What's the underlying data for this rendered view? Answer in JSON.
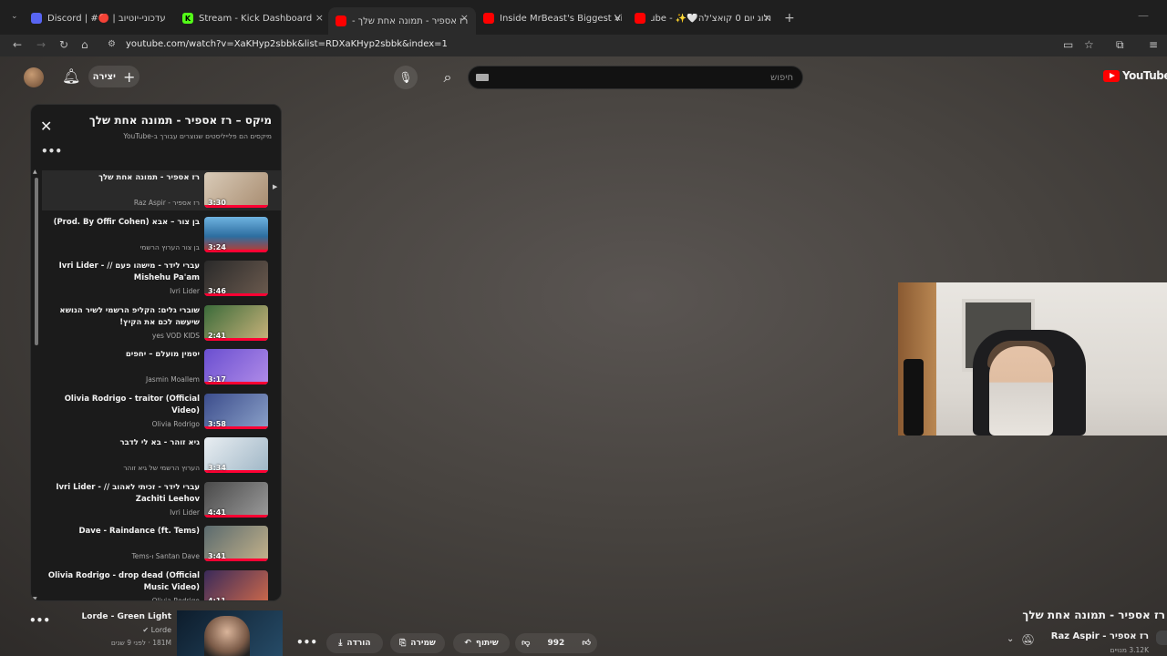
{
  "browser": {
    "tabs": [
      {
        "title": "Discord | #🔴 | עדכוני-יוטיוב",
        "favicon_color": "#5865f2",
        "active": false
      },
      {
        "title": "Stream - Kick Dashboard",
        "favicon_color": "#53fc18",
        "active": false
      },
      {
        "title": "רז אספיר - תמונה אחת שלך -",
        "favicon_color": "#ff0000",
        "active": true
      },
      {
        "title": "Inside MrBeast's Biggest Video",
        "favicon_color": "#ff0000",
        "active": false
      },
      {
        "title": "ולוג יום 0 קואצ'לה🤍✨ - Tube",
        "favicon_color": "#ff0000",
        "active": false
      }
    ],
    "tab_close_glyph": "×",
    "new_tab_glyph": "+",
    "url": "youtube.com/watch?v=XaKHyp2sbbk&list=RDXaKHyp2sbbk&index=1"
  },
  "youtube": {
    "logo_text": "YouTube",
    "search_placeholder": "חיפוש",
    "create_label": "יצירה",
    "create_icon": "+"
  },
  "playlist": {
    "title": "מיקס – רז אספיר - תמונה אחת שלך",
    "subtitle": "מיקסים הם פלייליסטים שנוצרים עבורך ב-YouTube",
    "close_glyph": "✕",
    "more_glyph": "•••",
    "items": [
      {
        "title": "רז אספיר - תמונה אחת שלך",
        "channel": "רז אספיר - Raz Aspir",
        "duration": "3:30",
        "current": true,
        "thumb": "linear-gradient(135deg,#d9cbb8,#a88c70)"
      },
      {
        "title": "בן צור – אבא (Prod. By Offir Cohen)",
        "channel": "בן צור הערוץ הרשמי",
        "duration": "3:24",
        "current": false,
        "thumb": "linear-gradient(180deg,#6fb3e0,#2d6ea0 55%,#c0392b)"
      },
      {
        "title": "עברי לידר - מישהו פעם // Ivri Lider - Mishehu Pa'am",
        "channel": "Ivri Lider",
        "duration": "3:46",
        "current": false,
        "thumb": "linear-gradient(135deg,#2a2a2a,#6b5a4e)"
      },
      {
        "title": "שוברי גלים: הקליפ הרשמי לשיר הנושא שיעשה לכם את הקיץ!",
        "channel": "yes VOD KIDS",
        "duration": "2:41",
        "current": false,
        "thumb": "linear-gradient(135deg,#3b6b3a,#c9b27a)"
      },
      {
        "title": "יסמין מועלם – יחפים",
        "channel": "Jasmin Moallem",
        "duration": "3:17",
        "current": false,
        "thumb": "linear-gradient(135deg,#6a4fd0,#b08be8)"
      },
      {
        "title": "Olivia Rodrigo - traitor (Official Video)",
        "channel": "Olivia Rodrigo",
        "duration": "3:58",
        "current": false,
        "thumb": "linear-gradient(135deg,#3c4d8c,#8aa0c8)"
      },
      {
        "title": "גיא זוהר - בא לי לדבר",
        "channel": "הערוץ הרשמי של גיא זוהר",
        "duration": "3:34",
        "current": false,
        "thumb": "linear-gradient(135deg,#e9eef2,#9fb6c6)"
      },
      {
        "title": "עברי לידר - זכיתי לאהוב // Ivri Lider - Zachiti Leehov",
        "channel": "Ivri Lider",
        "duration": "4:41",
        "current": false,
        "thumb": "linear-gradient(135deg,#4a4a4a,#9a9a9a)"
      },
      {
        "title": "Dave - Raindance (ft. Tems)",
        "channel": "Santan Dave ו-Tems",
        "duration": "3:41",
        "current": false,
        "thumb": "linear-gradient(135deg,#5a6a6e,#c4b28a)"
      },
      {
        "title": "Olivia Rodrigo - drop dead (Official Music Video)",
        "channel": "Olivia Rodrigo",
        "duration": "4:11",
        "current": false,
        "thumb": "linear-gradient(135deg,#3a2a5a,#d06a4a)"
      }
    ]
  },
  "video": {
    "title": "רז אספיר - תמונה אחת שלך",
    "channel": "רז אספיר - Raz Aspir",
    "subscribers": "3.12K מנויים",
    "likes": "992",
    "share_label": "שיתוף",
    "save_label": "שמירה",
    "download_label": "הורדה"
  },
  "next_card": {
    "title": "Lorde - Green Light",
    "channel": "Lorde",
    "meta": "181M · לפני 9 שנים"
  }
}
